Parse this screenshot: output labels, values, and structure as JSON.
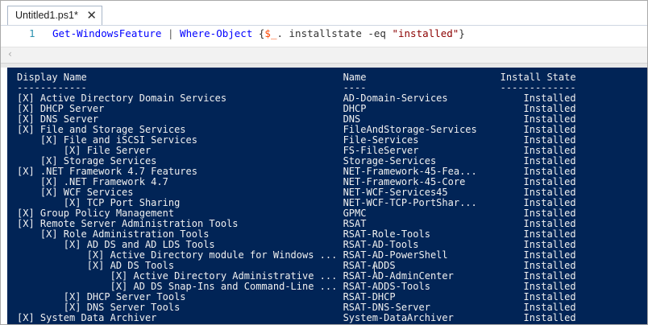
{
  "tab": {
    "title": "Untitled1.ps1*",
    "close_glyph": "✕"
  },
  "editor": {
    "line_number": "1",
    "tokens": {
      "cmd1": "Get-WindowsFeature",
      "pipe": " | ",
      "cmd2": "Where-Object",
      "brace_open": " {",
      "var": "$_",
      "prop": ". installstate ",
      "param": "-eq",
      "space": " ",
      "str": "\"installed\"",
      "brace_close": "}"
    }
  },
  "scrollbar": {
    "left_arrow": "‹"
  },
  "console": {
    "rows": [
      "Display Name                                            Name                       Install State",
      "------------                                            ----                       -------------",
      "[X] Active Directory Domain Services                    AD-Domain-Services             Installed",
      "[X] DHCP Server                                         DHCP                           Installed",
      "[X] DNS Server                                          DNS                            Installed",
      "[X] File and Storage Services                           FileAndStorage-Services        Installed",
      "    [X] File and iSCSI Services                         File-Services                  Installed",
      "        [X] File Server                                 FS-FileServer                  Installed",
      "    [X] Storage Services                                Storage-Services               Installed",
      "[X] .NET Framework 4.7 Features                         NET-Framework-45-Fea...        Installed",
      "    [X] .NET Framework 4.7                              NET-Framework-45-Core          Installed",
      "    [X] WCF Services                                    NET-WCF-Services45             Installed",
      "        [X] TCP Port Sharing                            NET-WCF-TCP-PortShar...        Installed",
      "[X] Group Policy Management                             GPMC                           Installed",
      "[X] Remote Server Administration Tools                  RSAT                           Installed",
      "    [X] Role Administration Tools                       RSAT-Role-Tools                Installed",
      "        [X] AD DS and AD LDS Tools                      RSAT-AD-Tools                  Installed",
      "            [X] Active Directory module for Windows ... RSAT-AD-PowerShell             Installed",
      "            [X] AD DS Tools                             RSAT-ADDS                      Installed",
      "                [X] Active Directory Administrative ... RSAT-AD-AdminCenter            Installed",
      "                [X] AD DS Snap-Ins and Command-Line ... RSAT-ADDS-Tools                Installed",
      "        [X] DHCP Server Tools                           RSAT-DHCP                      Installed",
      "        [X] DNS Server Tools                            RSAT-DNS-Server                Installed",
      "[X] System Data Archiver                                System-DataArchiver            Installed"
    ]
  },
  "colors": {
    "console_bg": "#012456",
    "console_fg": "#f0f0f0",
    "keyword": "#0000ff",
    "variable": "#ff4500",
    "string": "#8b0000",
    "line_number": "#2b91af"
  }
}
